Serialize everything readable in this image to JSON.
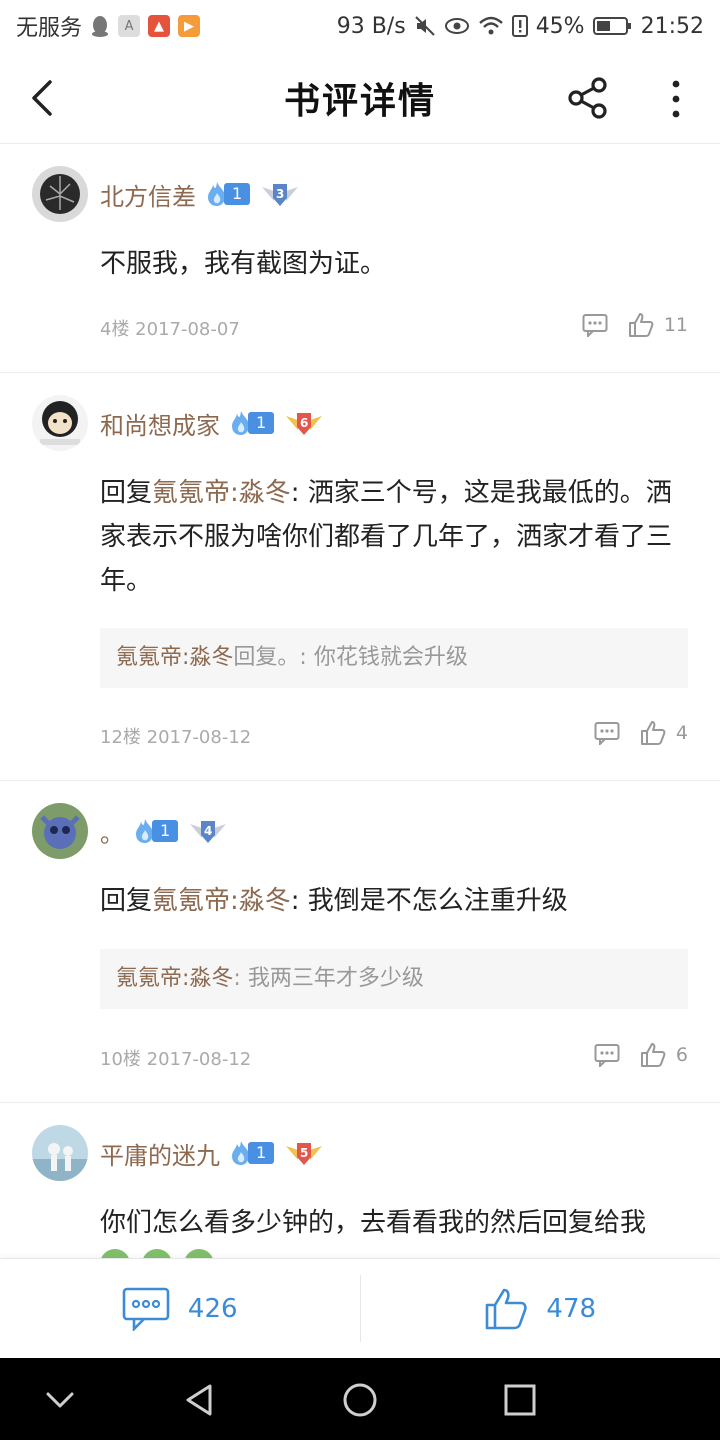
{
  "status_bar": {
    "carrier": "无服务",
    "speed": "93 B/s",
    "battery": "45%",
    "time": "21:52"
  },
  "header": {
    "title": "书评详情"
  },
  "comments": [
    {
      "username": "北方信差",
      "fire_level": "1",
      "badge_level": "3",
      "body_prefix": "",
      "mention": "",
      "body_text": "不服我，我有截图为证。",
      "meta": "4楼 2017-08-07",
      "likes": "11"
    },
    {
      "username": "和尚想成家",
      "fire_level": "1",
      "badge_level": "6",
      "body_prefix": "回复",
      "mention": "氪氪帝:淼冬",
      "body_text": ": 洒家三个号，这是我最低的。洒家表示不服为啥你们都看了几年了，洒家才看了三年。",
      "quote_user": "氪氪帝:淼冬",
      "quote_text": "回复。: 你花钱就会升级",
      "meta": "12楼 2017-08-12",
      "likes": "4"
    },
    {
      "username": "。",
      "fire_level": "1",
      "badge_level": "4",
      "body_prefix": "回复",
      "mention": "氪氪帝:淼冬",
      "body_text": ": 我倒是不怎么注重升级",
      "quote_user": "氪氪帝:淼冬",
      "quote_text": ": 我两三年才多少级",
      "meta": "10楼 2017-08-12",
      "likes": "6"
    },
    {
      "username": "平庸的迷九",
      "fire_level": "1",
      "badge_level": "5",
      "body_prefix": "",
      "mention": "",
      "body_text": "你们怎么看多少钟的，去看看我的然后回复给我"
    }
  ],
  "bottom_bar": {
    "comment_count": "426",
    "like_count": "478"
  },
  "colors": {
    "username": "#8d6a4f",
    "accent_blue": "#3c8bd6",
    "fire_badge": "#4a90e2"
  },
  "icons": [
    "back-arrow-icon",
    "share-icon",
    "more-vertical-icon",
    "comment-icon",
    "thumbs-up-icon",
    "fire-icon",
    "wing-badge-icon",
    "nav-down-icon",
    "nav-back-icon",
    "nav-home-icon",
    "nav-recent-icon"
  ]
}
